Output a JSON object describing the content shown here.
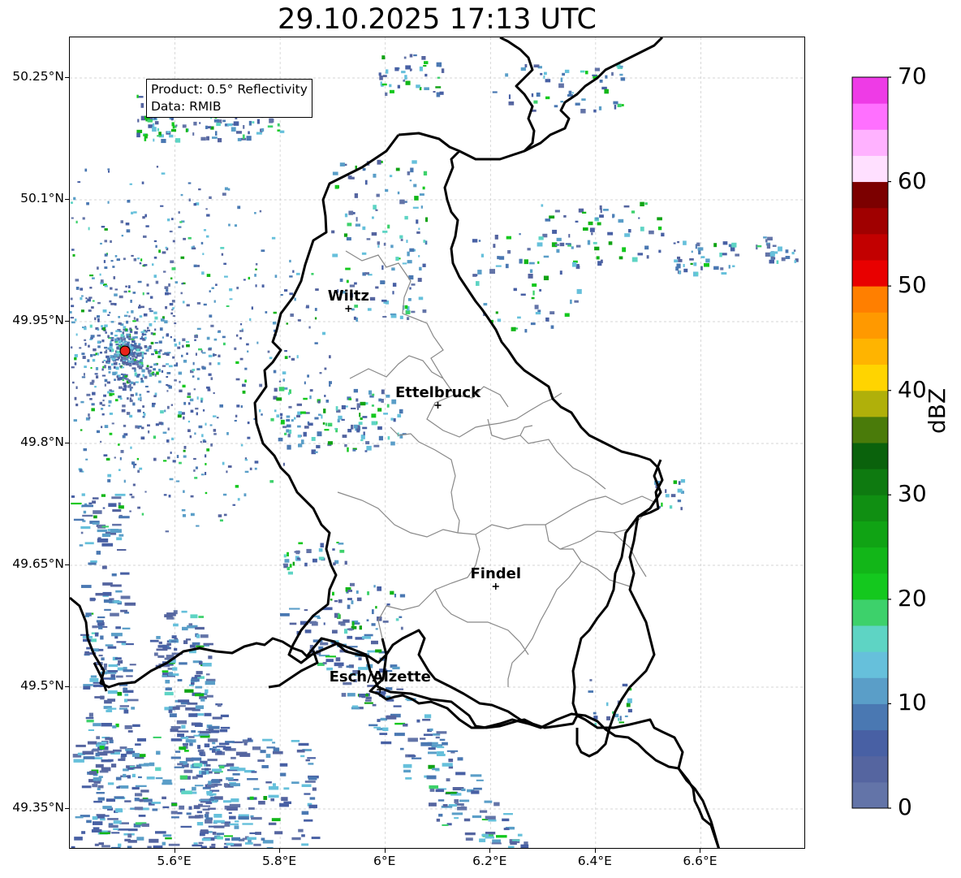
{
  "title": "29.10.2025 17:13 UTC",
  "info": {
    "product": "Product: 0.5° Reflectivity",
    "data": "Data: RMIB"
  },
  "lat_labels": [
    "50.25°N",
    "50.1°N",
    "49.95°N",
    "49.8°N",
    "49.65°N",
    "49.5°N",
    "49.35°N"
  ],
  "lon_labels": [
    "5.6°E",
    "5.8°E",
    "6°E",
    "6.2°E",
    "6.4°E",
    "6.6°E"
  ],
  "cities": [
    {
      "name": "Wiltz",
      "lon": 5.93,
      "lat": 49.966
    },
    {
      "name": "Ettelbruck",
      "lon": 6.1,
      "lat": 49.847
    },
    {
      "name": "Findel",
      "lon": 6.21,
      "lat": 49.624
    },
    {
      "name": "Esch/Alzette",
      "lon": 5.99,
      "lat": 49.497
    }
  ],
  "radar_site": {
    "lon": 5.505,
    "lat": 49.914,
    "color": "#e8231a"
  },
  "colorbar": {
    "label": "dBZ",
    "ticks": [
      "0",
      "10",
      "20",
      "30",
      "40",
      "50",
      "60",
      "70"
    ],
    "colors": [
      "#6374a8",
      "#5565a0",
      "#4860a4",
      "#4a78b2",
      "#5a9ec8",
      "#66c0db",
      "#5ed4c4",
      "#3dd16b",
      "#14c81e",
      "#12b618",
      "#10a314",
      "#108f12",
      "#0e7a10",
      "#0a620c",
      "#4a7b0a",
      "#b0b00a",
      "#ffd400",
      "#ffb400",
      "#ff9900",
      "#ff7f00",
      "#e80000",
      "#c20000",
      "#a00000",
      "#7c0000",
      "#ffe0ff",
      "#ffb2ff",
      "#ff70ff",
      "#ee3be6"
    ]
  }
}
